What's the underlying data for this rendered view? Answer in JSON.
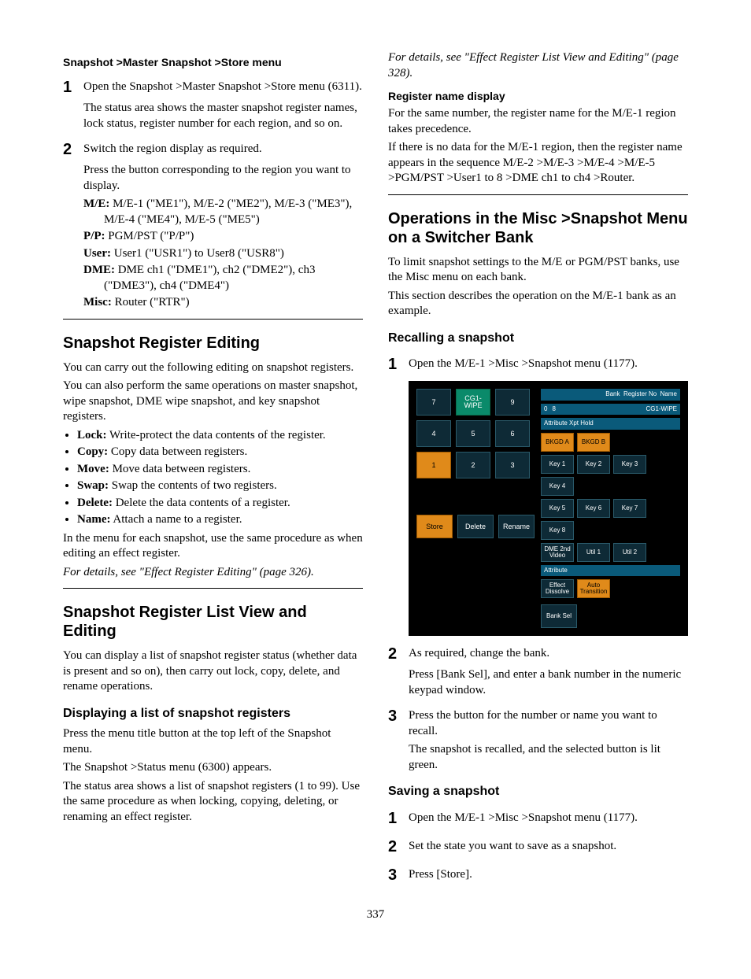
{
  "left": {
    "h4_1": "Snapshot >Master Snapshot >Store menu",
    "step1": "Open the Snapshot >Master Snapshot >Store menu (6311).",
    "step1_sub": "The status area shows the master snapshot register names, lock status, register number for each region, and so on.",
    "step2": "Switch the region display as required.",
    "step2_sub1": "Press the button corresponding to the region you want to display.",
    "me_label": "M/E:",
    "me_text": " M/E-1 (\"ME1\"), M/E-2 (\"ME2\"), M/E-3 (\"ME3\"), M/E-4 (\"ME4\"), M/E-5 (\"ME5\")",
    "pp_label": "P/P:",
    "pp_text": " PGM/PST (\"P/P\")",
    "user_label": "User:",
    "user_text": " User1 (\"USR1\") to User8 (\"USR8\")",
    "dme_label": "DME:",
    "dme_text": " DME ch1 (\"DME1\"), ch2 (\"DME2\"), ch3 (\"DME3\"), ch4 (\"DME4\")",
    "misc_label": "Misc:",
    "misc_text": " Router (\"RTR\")",
    "h2_1": "Snapshot Register Editing",
    "p1": "You can carry out the following editing on snapshot registers.",
    "p2": "You can also perform the same operations on master snapshot, wipe snapshot, DME wipe snapshot, and key snapshot registers.",
    "bul1b": "Lock:",
    "bul1t": " Write-protect the data contents of the register.",
    "bul2b": "Copy:",
    "bul2t": " Copy data between registers.",
    "bul3b": "Move:",
    "bul3t": " Move data between registers.",
    "bul4b": "Swap:",
    "bul4t": " Swap the contents of two registers.",
    "bul5b": "Delete:",
    "bul5t": " Delete the data contents of a register.",
    "bul6b": "Name:",
    "bul6t": " Attach a name to a register.",
    "p3": "In the menu for each snapshot, use the same procedure as when editing an effect register.",
    "ref1": "For details, see \"Effect Register Editing\" (page 326).",
    "h2_2": "Snapshot Register List View and Editing",
    "p4": "You can display a list of snapshot register status (whether data is present and so on), then carry out lock, copy, delete, and rename operations.",
    "h3_1": "Displaying a list of snapshot registers",
    "p5": "Press the menu title button at the top left of the Snapshot menu.",
    "p6": "The Snapshot >Status menu (6300) appears.",
    "p7": "The status area shows a list of snapshot registers (1 to 99). Use the same procedure as when locking, copying, deleting, or renaming an effect register."
  },
  "right": {
    "ref2": "For details, see \"Effect Register List View and Editing\" (page 328).",
    "h4_1": "Register name display",
    "p1": "For the same number, the register name for the M/E-1 region takes precedence.",
    "p2": "If there is no data for the M/E-1 region, then the register name appears in the sequence M/E-2 >M/E-3 >M/E-4 >M/E-5 >PGM/PST >User1 to 8 >DME ch1 to ch4 >Router.",
    "h2_1": "Operations in the Misc >Snapshot Menu on a Switcher Bank",
    "p3": "To limit snapshot settings to the M/E or PGM/PST banks, use the Misc menu on each bank.",
    "p4": "This section describes the operation on the M/E-1 bank as an example.",
    "h3_1": "Recalling a snapshot",
    "rstep1": "Open the M/E-1 >Misc >Snapshot menu (1177).",
    "rstep2": "As required, change the bank.",
    "rstep2_sub": "Press [Bank Sel], and enter a bank number in the numeric keypad window.",
    "rstep3": "Press the button for the number or name you want to recall.",
    "rstep3_sub": "The snapshot is recalled, and the selected button is lit green.",
    "h3_2": "Saving a snapshot",
    "sstep1": "Open the M/E-1 >Misc >Snapshot menu (1177).",
    "sstep2": "Set the state you want to save as a snapshot.",
    "sstep3": "Press [Store]."
  },
  "screenshot": {
    "keypad": [
      "7",
      "CG1-WIPE",
      "9",
      "4",
      "5",
      "6",
      "1",
      "2",
      "3"
    ],
    "hdr_labels": [
      "Bank",
      "Register No",
      "Name"
    ],
    "hdr_vals": [
      "0",
      "8",
      "CG1-WIPE"
    ],
    "attr_hold": "Attribute Xpt Hold",
    "bkgd": [
      "BKGD A",
      "BKGD B"
    ],
    "keys1": [
      "Key 1",
      "Key 2",
      "Key 3",
      "Key 4"
    ],
    "keys2": [
      "Key 5",
      "Key 6",
      "Key 7",
      "Key 8"
    ],
    "row3": [
      "DME 2nd Video",
      "Util 1",
      "Util 2"
    ],
    "attr": "Attribute",
    "attr_btns": [
      "Effect Dissolve",
      "Auto Transition"
    ],
    "bottom": [
      "Store",
      "Delete",
      "Rename",
      "Bank Sel"
    ]
  },
  "pagenum": "337"
}
